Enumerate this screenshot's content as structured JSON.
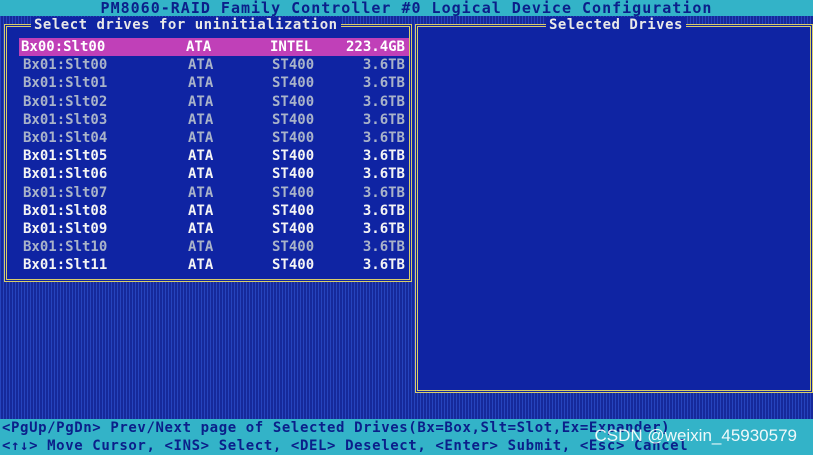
{
  "header": {
    "title": "PM8060-RAID Family Controller #0 Logical Device Configuration"
  },
  "left_panel": {
    "title": "Select drives for uninitialization",
    "drives": [
      {
        "name": "Bx00:Slt00",
        "type": "ATA",
        "model": "INTEL",
        "size": "223.4GB",
        "selected": true,
        "bright": true
      },
      {
        "name": "Bx01:Slt00",
        "type": "ATA",
        "model": "ST400",
        "size": "3.6TB",
        "selected": false,
        "bright": false
      },
      {
        "name": "Bx01:Slt01",
        "type": "ATA",
        "model": "ST400",
        "size": "3.6TB",
        "selected": false,
        "bright": false
      },
      {
        "name": "Bx01:Slt02",
        "type": "ATA",
        "model": "ST400",
        "size": "3.6TB",
        "selected": false,
        "bright": false
      },
      {
        "name": "Bx01:Slt03",
        "type": "ATA",
        "model": "ST400",
        "size": "3.6TB",
        "selected": false,
        "bright": false
      },
      {
        "name": "Bx01:Slt04",
        "type": "ATA",
        "model": "ST400",
        "size": "3.6TB",
        "selected": false,
        "bright": false
      },
      {
        "name": "Bx01:Slt05",
        "type": "ATA",
        "model": "ST400",
        "size": "3.6TB",
        "selected": false,
        "bright": true
      },
      {
        "name": "Bx01:Slt06",
        "type": "ATA",
        "model": "ST400",
        "size": "3.6TB",
        "selected": false,
        "bright": true
      },
      {
        "name": "Bx01:Slt07",
        "type": "ATA",
        "model": "ST400",
        "size": "3.6TB",
        "selected": false,
        "bright": false
      },
      {
        "name": "Bx01:Slt08",
        "type": "ATA",
        "model": "ST400",
        "size": "3.6TB",
        "selected": false,
        "bright": true
      },
      {
        "name": "Bx01:Slt09",
        "type": "ATA",
        "model": "ST400",
        "size": "3.6TB",
        "selected": false,
        "bright": true
      },
      {
        "name": "Bx01:Slt10",
        "type": "ATA",
        "model": "ST400",
        "size": "3.6TB",
        "selected": false,
        "bright": false
      },
      {
        "name": "Bx01:Slt11",
        "type": "ATA",
        "model": "ST400",
        "size": "3.6TB",
        "selected": false,
        "bright": true
      }
    ]
  },
  "right_panel": {
    "title": "Selected Drives"
  },
  "footer": {
    "line1": "<PgUp/PgDn> Prev/Next page of Selected Drives(Bx=Box,Slt=Slot,Ex=Expander)",
    "line2": "<↑↓> Move Cursor, <INS> Select, <DEL> Deselect, <Enter> Submit, <Esc> Cancel"
  },
  "watermark": "CSDN @weixin_45930579",
  "colors": {
    "screen_bg": "#1f38a8",
    "bar_bg": "#33b3c8",
    "border": "#d9cd6a",
    "highlight": "#c040b8"
  }
}
